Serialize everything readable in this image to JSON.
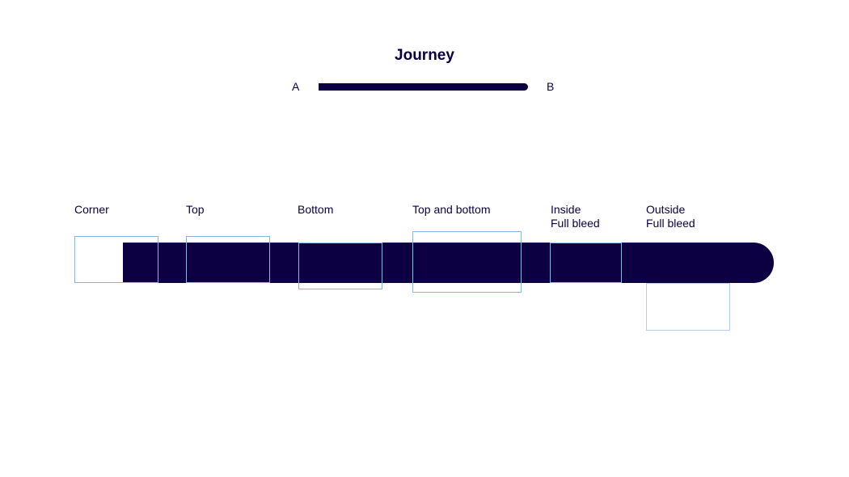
{
  "title": "Journey",
  "journey": {
    "start_label": "A",
    "end_label": "B"
  },
  "variants": [
    {
      "id": "corner",
      "label": "Corner"
    },
    {
      "id": "top",
      "label": "Top"
    },
    {
      "id": "bottom",
      "label": "Bottom"
    },
    {
      "id": "top-and-bottom",
      "label": "Top and bottom"
    },
    {
      "id": "inside-full-bleed",
      "label_line1": "Inside",
      "label_line2": "Full bleed"
    },
    {
      "id": "outside-full-bleed",
      "label_line1": "Outside",
      "label_line2": "Full bleed"
    }
  ],
  "colors": {
    "bar": "#0c0042",
    "box_outline": "#8fb4e0",
    "text": "#0c0042"
  }
}
